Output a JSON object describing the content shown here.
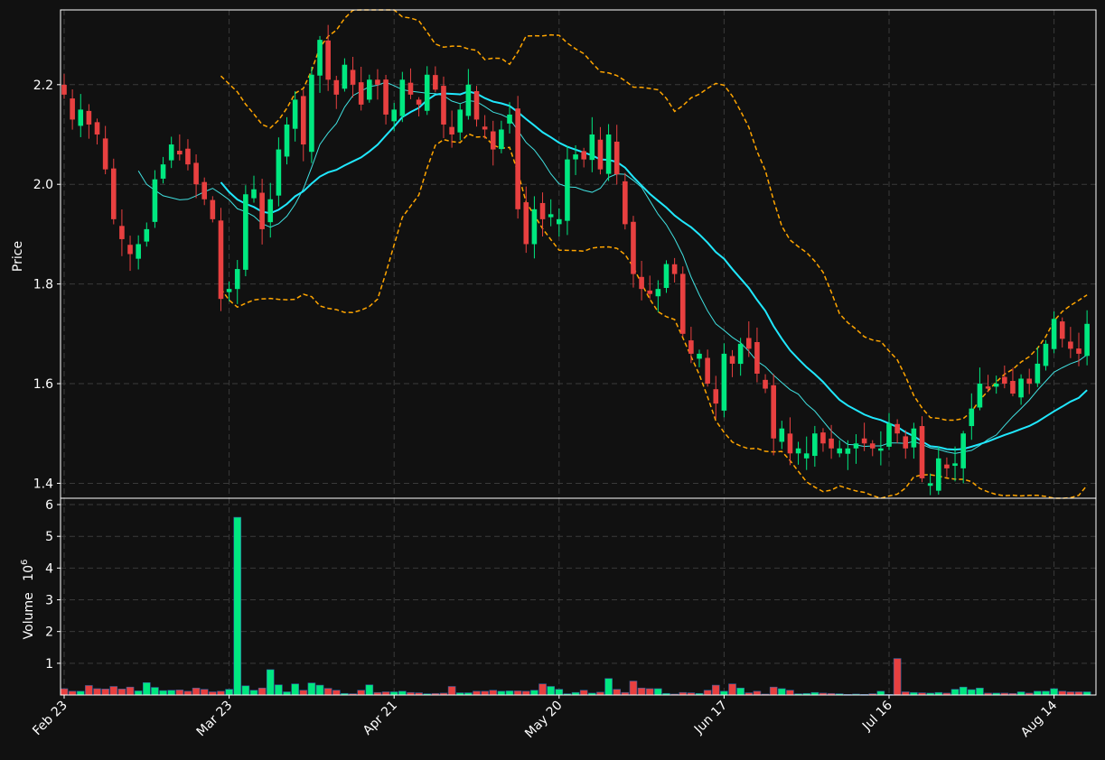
{
  "colors": {
    "background": "#111111",
    "up": "#00e880",
    "down": "#e84040",
    "ma_fast": "#40e0e0",
    "ma_slow": "#20e8ff",
    "bands": "#ffa500",
    "frame": "#ffffff",
    "grid": "#3a3a3a"
  },
  "chart_data": {
    "type": "candlestick",
    "price_ylabel": "Price",
    "volume_ylabel": "Volume",
    "volume_exponent_base": "10",
    "volume_exponent": "6",
    "x_tick_labels": [
      {
        "index": 0,
        "label": "Feb 23"
      },
      {
        "index": 20,
        "label": "Mar 23"
      },
      {
        "index": 40,
        "label": "Apr 21"
      },
      {
        "index": 60,
        "label": "May 20"
      },
      {
        "index": 80,
        "label": "Jun 17"
      },
      {
        "index": 100,
        "label": "Jul 16"
      },
      {
        "index": 120,
        "label": "Aug 14"
      }
    ],
    "price_yticks": [
      "1.4",
      "1.6",
      "1.8",
      "2.0",
      "2.2"
    ],
    "price_ylim": [
      1.37,
      2.35
    ],
    "volume_yticks": [
      "1",
      "2",
      "3",
      "4",
      "5",
      "6"
    ],
    "volume_ylim": [
      0,
      6.2
    ],
    "grid": true,
    "closes": [
      2.18,
      2.13,
      2.15,
      2.12,
      2.1,
      2.03,
      1.93,
      1.89,
      1.86,
      1.88,
      1.91,
      2.01,
      2.04,
      2.08,
      2.06,
      2.04,
      2.0,
      1.97,
      1.93,
      1.77,
      1.79,
      1.83,
      1.98,
      1.99,
      1.91,
      1.97,
      2.07,
      2.12,
      2.17,
      2.08,
      2.22,
      2.29,
      2.21,
      2.18,
      2.24,
      2.2,
      2.16,
      2.21,
      2.2,
      2.14,
      2.15,
      2.21,
      2.18,
      2.16,
      2.22,
      2.19,
      2.12,
      2.1,
      2.15,
      2.2,
      2.13,
      2.11,
      2.07,
      2.11,
      2.14,
      1.95,
      1.88,
      1.95,
      1.93,
      1.94,
      1.93,
      2.05,
      2.06,
      2.05,
      2.1,
      2.03,
      2.1,
      2.02,
      1.92,
      1.82,
      1.79,
      1.78,
      1.79,
      1.84,
      1.82,
      1.7,
      1.66,
      1.66,
      1.6,
      1.56,
      1.66,
      1.64,
      1.68,
      1.67,
      1.62,
      1.59,
      1.49,
      1.51,
      1.46,
      1.47,
      1.46,
      1.5,
      1.48,
      1.47,
      1.47,
      1.47,
      1.48,
      1.48,
      1.47,
      1.47,
      1.52,
      1.5,
      1.47,
      1.51,
      1.41,
      1.4,
      1.45,
      1.43,
      1.44,
      1.5,
      1.55,
      1.6,
      1.59,
      1.6,
      1.6,
      1.58,
      1.61,
      1.6,
      1.64,
      1.68,
      1.73,
      1.69,
      1.67,
      1.66,
      1.72
    ],
    "volumes": [
      0.2,
      0.12,
      0.12,
      0.3,
      0.2,
      0.19,
      0.27,
      0.19,
      0.25,
      0.13,
      0.39,
      0.24,
      0.14,
      0.15,
      0.16,
      0.12,
      0.22,
      0.18,
      0.1,
      0.12,
      0.18,
      5.6,
      0.29,
      0.15,
      0.22,
      0.8,
      0.32,
      0.1,
      0.35,
      0.15,
      0.38,
      0.31,
      0.21,
      0.15,
      0.05,
      0.04,
      0.15,
      0.32,
      0.08,
      0.1,
      0.1,
      0.12,
      0.08,
      0.07,
      0.04,
      0.05,
      0.06,
      0.27,
      0.07,
      0.07,
      0.12,
      0.12,
      0.15,
      0.12,
      0.13,
      0.13,
      0.12,
      0.15,
      0.35,
      0.27,
      0.18,
      0.04,
      0.08,
      0.15,
      0.06,
      0.09,
      0.52,
      0.18,
      0.08,
      0.44,
      0.22,
      0.2,
      0.2,
      0.05,
      0.03,
      0.08,
      0.07,
      0.05,
      0.15,
      0.31,
      0.12,
      0.35,
      0.22,
      0.07,
      0.12,
      0.03,
      0.25,
      0.2,
      0.15,
      0.04,
      0.05,
      0.08,
      0.06,
      0.05,
      0.04,
      0.02,
      0.03,
      0.02,
      0.04,
      0.12,
      0.02,
      1.15,
      0.1,
      0.08,
      0.07,
      0.06,
      0.08,
      0.06,
      0.18,
      0.25,
      0.17,
      0.22,
      0.06,
      0.06,
      0.06,
      0.05,
      0.1,
      0.06,
      0.12,
      0.12,
      0.2,
      0.12,
      0.1,
      0.1,
      0.1,
      0.22
    ],
    "n_candles": 125
  }
}
